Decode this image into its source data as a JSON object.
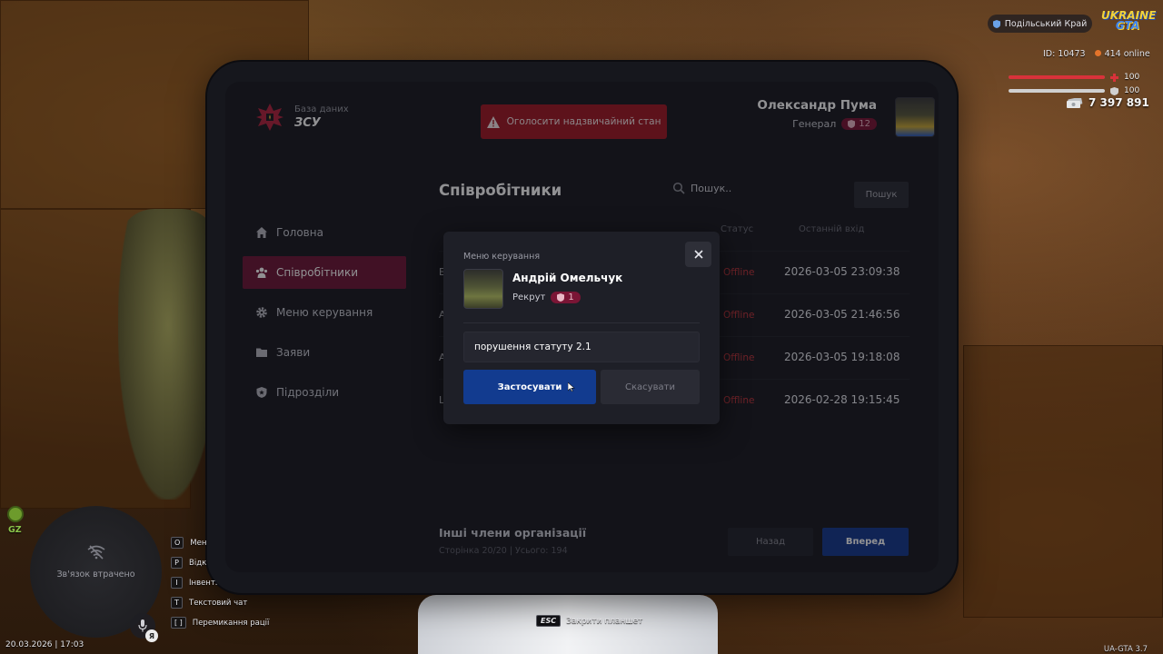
{
  "brand": {
    "subtitle": "База даних",
    "title": "ЗСУ"
  },
  "header": {
    "emergency_label": "Оголосити надзвичайний стан",
    "user_name": "Олександр Пума",
    "user_rank": "Генерал",
    "user_rank_level": "12"
  },
  "sidebar": {
    "items": [
      {
        "label": "Головна",
        "icon": "home-icon"
      },
      {
        "label": "Співробітники",
        "icon": "users-icon",
        "active": true
      },
      {
        "label": "Меню керування",
        "icon": "gear-icon"
      },
      {
        "label": "Заяви",
        "icon": "folder-icon"
      },
      {
        "label": "Підрозділи",
        "icon": "shield-icon"
      }
    ]
  },
  "main": {
    "title": "Співробітники",
    "search_placeholder": "Пошук..",
    "search_button": "Пошук",
    "columns": {
      "status": "Статус",
      "last_login": "Останній вхід"
    },
    "rows": [
      {
        "first": "Б",
        "status": "Offline",
        "last_login": "2026-03-05 23:09:38"
      },
      {
        "first": "А",
        "status": "Offline",
        "last_login": "2026-03-05 21:46:56"
      },
      {
        "first": "А",
        "status": "Offline",
        "last_login": "2026-03-05 19:18:08"
      },
      {
        "first": "L",
        "status": "Offline",
        "last_login": "2026-02-28 19:15:45"
      }
    ],
    "footer_title": "Інші члени організації",
    "footer_sub": "Сторінка 20/20 | Усього: 194",
    "back_button": "Назад",
    "next_button": "Вперед"
  },
  "modal": {
    "label": "Меню керування",
    "name": "Андрій Омельчук",
    "rank": "Рекрут",
    "rank_level": "1",
    "reason_value": "порушення статуту 2.1",
    "apply_button": "Застосувати",
    "cancel_button": "Скасувати"
  },
  "hud": {
    "region": "Подільський Край",
    "logo_line1": "UKRAINE",
    "logo_line2": "GTA",
    "player_id": "ID: 10473",
    "online": "414 online",
    "health": 100,
    "health_label": "100",
    "armor": 100,
    "armor_label": "100",
    "money": "7 397 891",
    "gz_label": "GZ",
    "minimap_status": "Зв'язок втрачено",
    "mic_badge": "Я",
    "datetime": "20.03.2026 | 17:03",
    "hotkeys": [
      {
        "key": "O",
        "label": "Мен"
      },
      {
        "key": "P",
        "label": "Відк"
      },
      {
        "key": "I",
        "label": "Інвент."
      },
      {
        "key": "T",
        "label": "Текстовий чат"
      },
      {
        "key": "[ ]",
        "label": "Перемикання рації"
      }
    ],
    "esc_key": "ESC",
    "esc_label": "Закрити планшет",
    "version": "UA-GTA 3.7"
  },
  "colors": {
    "accent_active": "#6e1737",
    "emergency": "#a11825",
    "primary_button": "#123b8f",
    "offline": "#c1353c",
    "health": "#d8323a",
    "armor": "#d0d0d0"
  }
}
